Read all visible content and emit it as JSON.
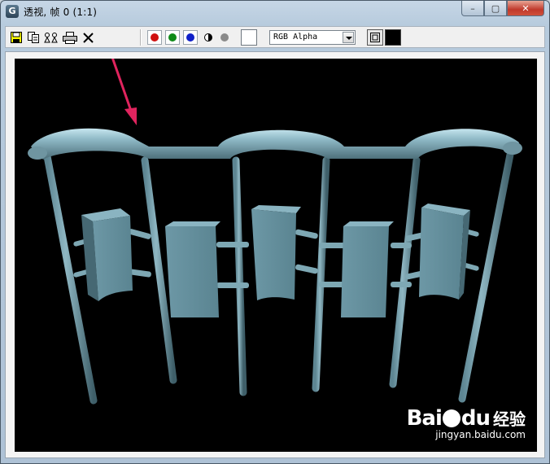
{
  "window": {
    "title": "透视, 帧 0 (1:1)",
    "app_icon_letter": "G",
    "controls": {
      "minimize": "–",
      "maximize": "▢",
      "close": "✕"
    }
  },
  "toolbar": {
    "tools": [
      "save-icon",
      "copy-icon",
      "clone-icon",
      "print-icon",
      "clear-icon"
    ],
    "channels": [
      {
        "name": "red",
        "color": "#d01010"
      },
      {
        "name": "green",
        "color": "#0f8a18"
      },
      {
        "name": "blue",
        "color": "#1020c8"
      }
    ],
    "channel_display": "RGB Alpha",
    "swatch_color": "#ffffff"
  },
  "watermark": {
    "logo": "Bai",
    "logo_tail": "du",
    "suffix": "经验",
    "url": "jingyan.baidu.com"
  },
  "colors": {
    "accent_arrow": "#e0245e",
    "viewport_bg": "#000000",
    "object_color": "#6e9aa8"
  }
}
